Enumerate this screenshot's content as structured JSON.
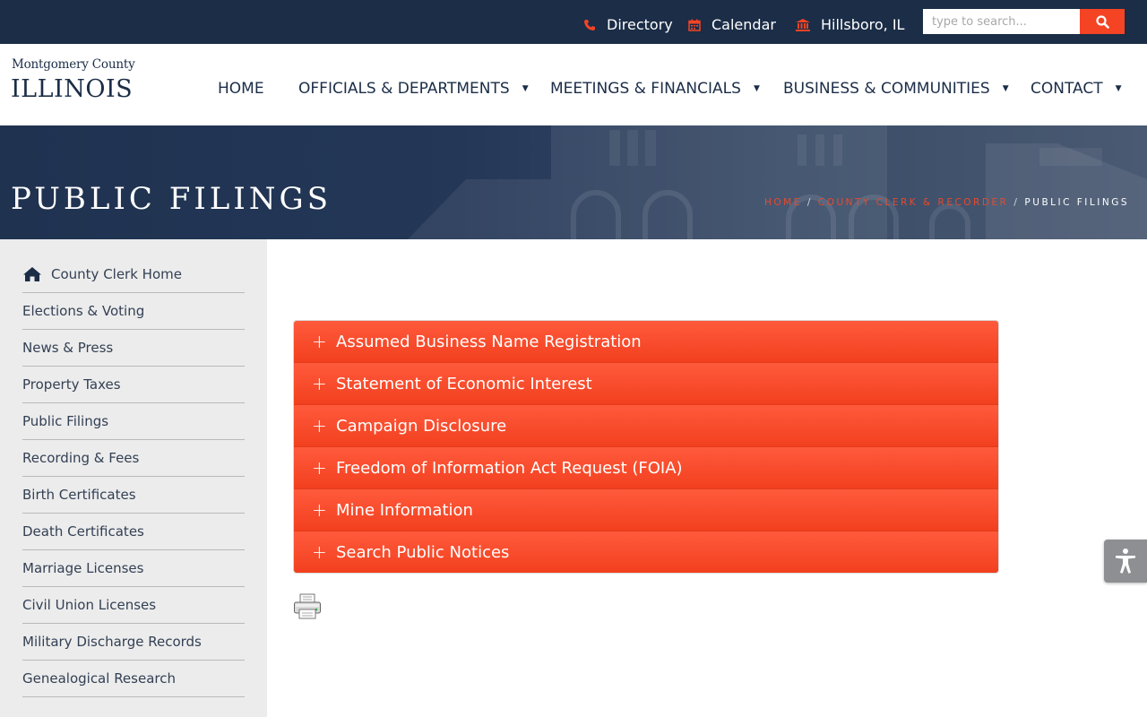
{
  "topbar": {
    "links": [
      {
        "label": "Directory",
        "icon": "phone-icon"
      },
      {
        "label": "Calendar",
        "icon": "calendar-icon"
      },
      {
        "label": "Hillsboro, IL",
        "icon": "bank-icon"
      }
    ],
    "search_placeholder": "type to search..."
  },
  "logo": {
    "line1": "Montgomery County",
    "line2": "ILLINOIS"
  },
  "nav": [
    {
      "label": "HOME"
    },
    {
      "label": "OFFICIALS & DEPARTMENTS"
    },
    {
      "label": "MEETINGS & FINANCIALS"
    },
    {
      "label": "BUSINESS & COMMUNITIES"
    },
    {
      "label": "CONTACT"
    }
  ],
  "hero": {
    "title": "PUBLIC FILINGS",
    "breadcrumb": {
      "home": "HOME",
      "parent": "COUNTY CLERK & RECORDER",
      "current": "PUBLIC FILINGS",
      "separator": "/"
    }
  },
  "sidebar": {
    "items": [
      {
        "label": "County Clerk Home"
      },
      {
        "label": "Elections & Voting"
      },
      {
        "label": "News & Press"
      },
      {
        "label": "Property Taxes"
      },
      {
        "label": "Public Filings"
      },
      {
        "label": "Recording & Fees"
      },
      {
        "label": "Birth Certificates"
      },
      {
        "label": "Death Certificates"
      },
      {
        "label": "Marriage Licenses"
      },
      {
        "label": "Civil Union Licenses"
      },
      {
        "label": "Military Discharge Records"
      },
      {
        "label": "Genealogical Research"
      }
    ]
  },
  "accordion": {
    "sections": [
      {
        "label": "Assumed Business Name Registration"
      },
      {
        "label": "Statement of Economic Interest"
      },
      {
        "label": "Campaign Disclosure"
      },
      {
        "label": "Freedom of Information Act Request (FOIA)"
      },
      {
        "label": "Mine Information"
      },
      {
        "label": "Search Public Notices"
      }
    ],
    "expand_symbol": "+"
  },
  "colors": {
    "navy": "#1b2d47",
    "accent": "#f44424",
    "sidebar_bg": "#ececec"
  }
}
